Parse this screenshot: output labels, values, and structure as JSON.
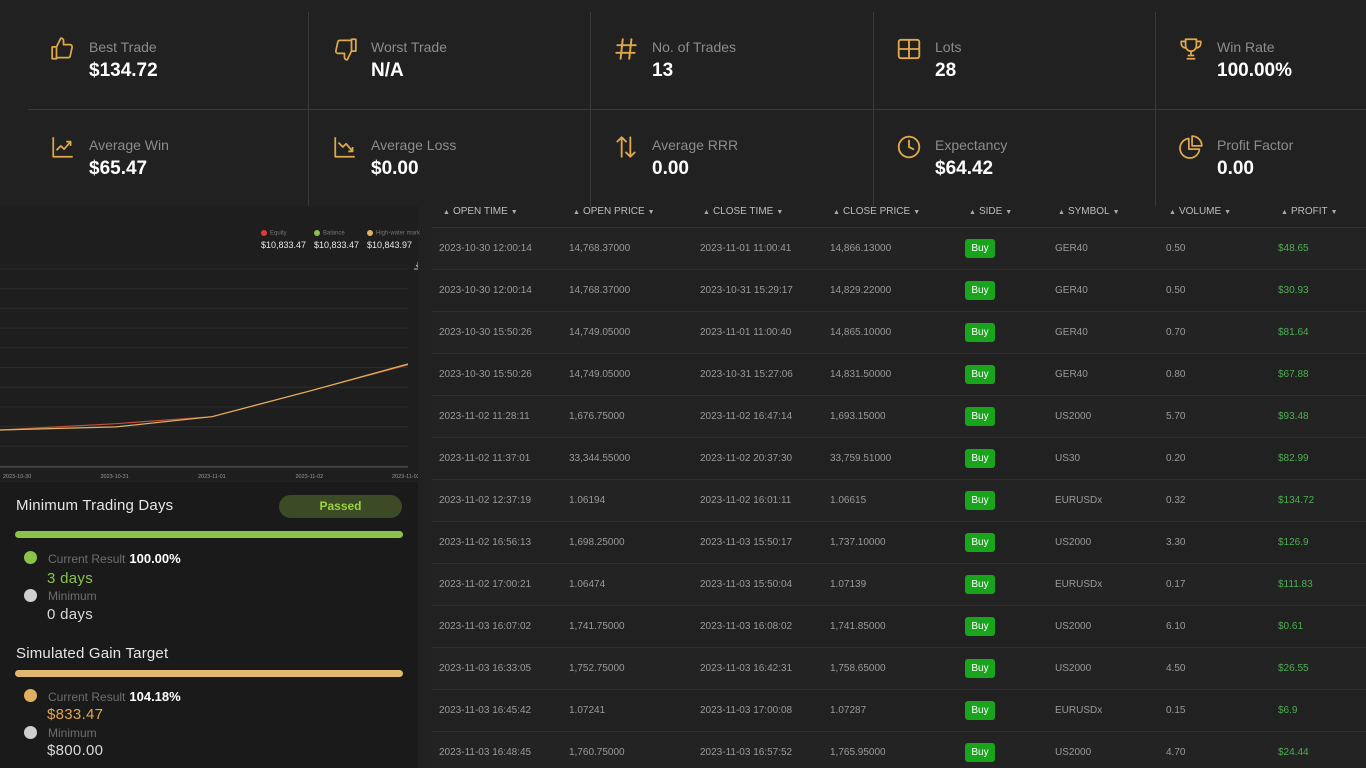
{
  "stats": [
    {
      "label": "Best Trade",
      "value": "$134.72",
      "icon": "thumbs-up-icon"
    },
    {
      "label": "Worst Trade",
      "value": "N/A",
      "icon": "thumbs-down-icon"
    },
    {
      "label": "No. of Trades",
      "value": "13",
      "icon": "hash-icon"
    },
    {
      "label": "Lots",
      "value": "28",
      "icon": "grid-icon"
    },
    {
      "label": "Win Rate",
      "value": "100.00%",
      "icon": "trophy-icon"
    },
    {
      "label": "Average Win",
      "value": "$65.47",
      "icon": "trend-up-icon"
    },
    {
      "label": "Average Loss",
      "value": "$0.00",
      "icon": "trend-down-icon"
    },
    {
      "label": "Average RRR",
      "value": "0.00",
      "icon": "swap-arrows-icon"
    },
    {
      "label": "Expectancy",
      "value": "$64.42",
      "icon": "clock-icon"
    },
    {
      "label": "Profit Factor",
      "value": "0.00",
      "icon": "pie-chart-icon"
    }
  ],
  "chart": {
    "legend": [
      {
        "name": "Equity",
        "value": "$10,833.47",
        "color": "#e53935"
      },
      {
        "name": "Balance",
        "value": "$10,833.47",
        "color": "#8bc34a"
      },
      {
        "name": "High-water mark",
        "value": "$10,843.97",
        "color": "#e0b060"
      }
    ],
    "xticks": [
      "2023-10-30",
      "2023-10-31",
      "2023-11-01",
      "2023-11-02",
      "2023-11-03"
    ]
  },
  "chart_data": {
    "type": "line",
    "x": [
      "2023-10-30",
      "2023-10-31",
      "2023-11-01",
      "2023-11-02",
      "2023-11-03"
    ],
    "series": [
      {
        "name": "Equity",
        "values": [
          10000,
          10080,
          10170,
          10500,
          10833.47
        ]
      },
      {
        "name": "Balance",
        "values": [
          10000,
          10040,
          10170,
          10500,
          10833.47
        ]
      },
      {
        "name": "High-water mark",
        "values": [
          10000,
          10040,
          10170,
          10500,
          10843.97
        ]
      }
    ]
  },
  "objectives": {
    "min_days": {
      "title": "Minimum Trading Days",
      "status": "Passed",
      "current_label": "Current Result",
      "current_pct": "100.00%",
      "current_value": "3 days",
      "min_label": "Minimum",
      "min_value": "0 days",
      "progress": 1.0
    },
    "gain": {
      "title": "Simulated Gain Target",
      "current_label": "Current Result",
      "current_pct": "104.18%",
      "current_value": "$833.47",
      "min_label": "Minimum",
      "min_value": "$800.00",
      "progress": 1.0
    }
  },
  "table": {
    "headers": [
      "OPEN TIME",
      "OPEN PRICE",
      "CLOSE TIME",
      "CLOSE PRICE",
      "SIDE",
      "SYMBOL",
      "VOLUME",
      "PROFIT"
    ],
    "rows": [
      [
        "2023-10-30 12:00:14",
        "14,768.37000",
        "2023-11-01 11:00:41",
        "14,866.13000",
        "Buy",
        "GER40",
        "0.50",
        "$48.65"
      ],
      [
        "2023-10-30 12:00:14",
        "14,768.37000",
        "2023-10-31 15:29:17",
        "14,829.22000",
        "Buy",
        "GER40",
        "0.50",
        "$30.93"
      ],
      [
        "2023-10-30 15:50:26",
        "14,749.05000",
        "2023-11-01 11:00:40",
        "14,865.10000",
        "Buy",
        "GER40",
        "0.70",
        "$81.64"
      ],
      [
        "2023-10-30 15:50:26",
        "14,749.05000",
        "2023-10-31 15:27:06",
        "14,831.50000",
        "Buy",
        "GER40",
        "0.80",
        "$67.88"
      ],
      [
        "2023-11-02 11:28:11",
        "1,676.75000",
        "2023-11-02 16:47:14",
        "1,693.15000",
        "Buy",
        "US2000",
        "5.70",
        "$93.48"
      ],
      [
        "2023-11-02 11:37:01",
        "33,344.55000",
        "2023-11-02 20:37:30",
        "33,759.51000",
        "Buy",
        "US30",
        "0.20",
        "$82.99"
      ],
      [
        "2023-11-02 12:37:19",
        "1.06194",
        "2023-11-02 16:01:11",
        "1.06615",
        "Buy",
        "EURUSDx",
        "0.32",
        "$134.72"
      ],
      [
        "2023-11-02 16:56:13",
        "1,698.25000",
        "2023-11-03 15:50:17",
        "1,737.10000",
        "Buy",
        "US2000",
        "3.30",
        "$126.9"
      ],
      [
        "2023-11-02 17:00:21",
        "1.06474",
        "2023-11-03 15:50:04",
        "1.07139",
        "Buy",
        "EURUSDx",
        "0.17",
        "$111.83"
      ],
      [
        "2023-11-03 16:07:02",
        "1,741.75000",
        "2023-11-03 16:08:02",
        "1,741.85000",
        "Buy",
        "US2000",
        "6.10",
        "$0.61"
      ],
      [
        "2023-11-03 16:33:05",
        "1,752.75000",
        "2023-11-03 16:42:31",
        "1,758.65000",
        "Buy",
        "US2000",
        "4.50",
        "$26.55"
      ],
      [
        "2023-11-03 16:45:42",
        "1.07241",
        "2023-11-03 17:00:08",
        "1.07287",
        "Buy",
        "EURUSDx",
        "0.15",
        "$6.9"
      ],
      [
        "2023-11-03 16:48:45",
        "1,760.75000",
        "2023-11-03 16:57:52",
        "1,765.95000",
        "Buy",
        "US2000",
        "4.70",
        "$24.44"
      ]
    ]
  },
  "colors": {
    "accent": "#e0a84a",
    "green": "#8bc34a",
    "buy": "#18a51b"
  }
}
